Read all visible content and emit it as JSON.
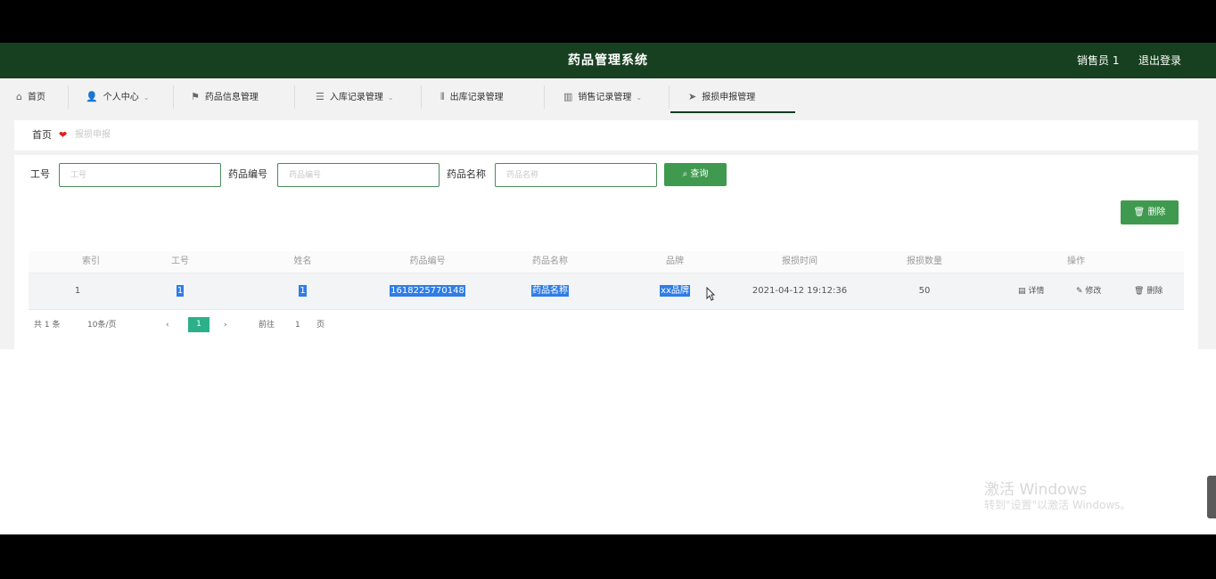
{
  "app": {
    "title": "药品管理系统",
    "user": "销售员 1",
    "logout": "退出登录"
  },
  "nav": {
    "items": [
      {
        "icon": "home-icon",
        "label": "首页",
        "chevron": false
      },
      {
        "icon": "user-icon",
        "label": "个人中心",
        "chevron": true
      },
      {
        "icon": "flag-icon",
        "label": "药品信息管理",
        "chevron": false
      },
      {
        "icon": "list-icon",
        "label": "入库记录管理",
        "chevron": true
      },
      {
        "icon": "columns-icon",
        "label": "出库记录管理",
        "chevron": false
      },
      {
        "icon": "chart-icon",
        "label": "销售记录管理",
        "chevron": true
      },
      {
        "icon": "send-icon",
        "label": "报损申报管理",
        "chevron": false
      }
    ]
  },
  "breadcrumb": {
    "home": "首页",
    "current": "报损申报"
  },
  "search": {
    "fields": [
      {
        "label": "工号",
        "placeholder": "工号"
      },
      {
        "label": "药品编号",
        "placeholder": "药品编号"
      },
      {
        "label": "药品名称",
        "placeholder": "药品名称"
      }
    ],
    "button": "查询"
  },
  "actions": {
    "delete": "删除"
  },
  "table": {
    "headers": [
      "索引",
      "工号",
      "姓名",
      "药品编号",
      "药品名称",
      "品牌",
      "报损时间",
      "报损数量",
      "操作"
    ],
    "rows": [
      {
        "index": "1",
        "emp_no": "1",
        "name": "1",
        "drug_no": "1618225770148",
        "drug_name": "药品名称",
        "brand": "xx品牌",
        "time": "2021-04-12 19:12:36",
        "qty": "50"
      }
    ],
    "row_actions": [
      "详情",
      "修改",
      "删除"
    ]
  },
  "pager": {
    "total": "共 1 条",
    "page_size": "10条/页",
    "current": "1",
    "goto": "前往",
    "goto_value": "1",
    "page_unit": "页"
  },
  "watermark": {
    "line1": "激活 Windows",
    "line2": "转到\"设置\"以激活 Windows。"
  },
  "colors": {
    "header_bg": "#16401f",
    "primary_green": "#3f9a4f",
    "pager_active": "#2bb08a",
    "selection": "#2f7de6"
  }
}
